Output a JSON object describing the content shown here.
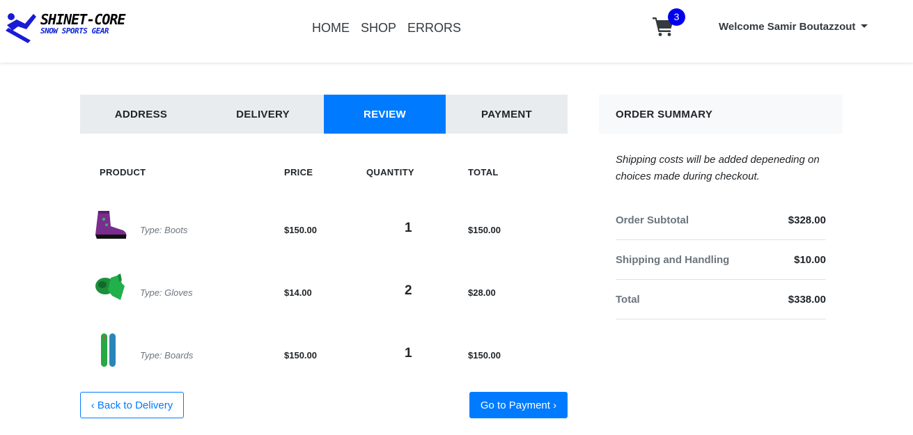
{
  "header": {
    "brand_line1": "SHINET-CORE",
    "brand_line2": "SNOW SPORTS GEAR",
    "nav": [
      {
        "label": "HOME"
      },
      {
        "label": "SHOP"
      },
      {
        "label": "ERRORS"
      }
    ],
    "cart_count": "3",
    "user_greeting": "Welcome Samir Boutazzout"
  },
  "steps": {
    "items": [
      {
        "label": "ADDRESS"
      },
      {
        "label": "DELIVERY"
      },
      {
        "label": "REVIEW"
      },
      {
        "label": "PAYMENT"
      }
    ],
    "active": "REVIEW"
  },
  "table": {
    "headers": {
      "product": "PRODUCT",
      "price": "PRICE",
      "quantity": "QUANTITY",
      "total": "TOTAL"
    },
    "rows": [
      {
        "icon": "boot-icon",
        "type": "Type: Boots",
        "price": "$150.00",
        "quantity": "1",
        "total": "$150.00"
      },
      {
        "icon": "glove-icon",
        "type": "Type: Gloves",
        "price": "$14.00",
        "quantity": "2",
        "total": "$28.00"
      },
      {
        "icon": "board-icon",
        "type": "Type: Boards",
        "price": "$150.00",
        "quantity": "1",
        "total": "$150.00"
      }
    ]
  },
  "buttons": {
    "back": "Back to Delivery",
    "next": "Go to Payment"
  },
  "summary": {
    "title": "ORDER SUMMARY",
    "note": "Shipping costs will be added depeneding on choices made during checkout.",
    "rows": [
      {
        "label": "Order Subtotal",
        "value": "$328.00"
      },
      {
        "label": "Shipping and Handling",
        "value": "$10.00"
      },
      {
        "label": "Total",
        "value": "$338.00"
      }
    ]
  },
  "colors": {
    "primary": "#007bff",
    "badge": "#0000ee",
    "tab_bg": "#e9ecef",
    "muted": "#6c757d"
  }
}
